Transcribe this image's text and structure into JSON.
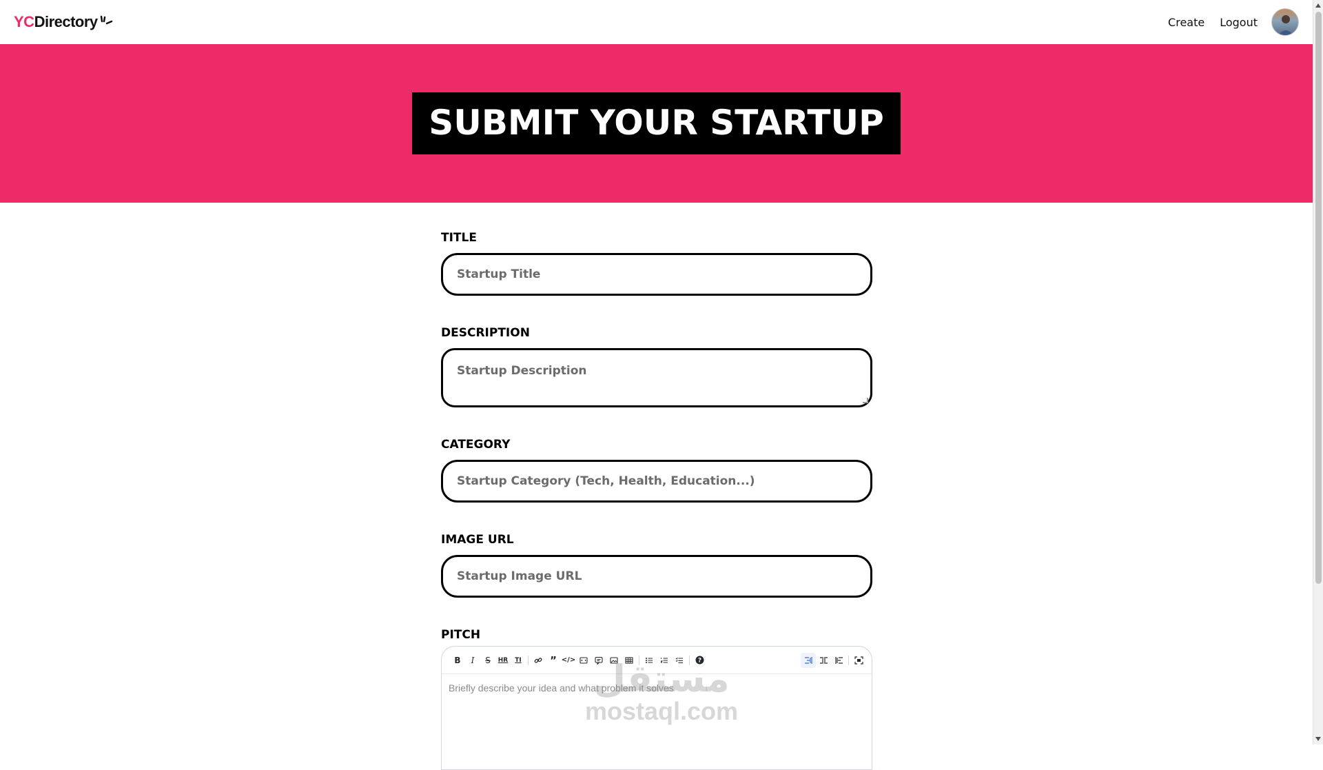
{
  "navbar": {
    "logo_yc": "YC",
    "logo_rest": "Directory",
    "links": [
      "Create",
      "Logout"
    ]
  },
  "hero": {
    "title": "SUBMIT YOUR STARTUP"
  },
  "form": {
    "title": {
      "label": "Title",
      "placeholder": "Startup Title"
    },
    "description": {
      "label": "Description",
      "placeholder": "Startup Description"
    },
    "category": {
      "label": "Category",
      "placeholder": "Startup Category (Tech, Health, Education...)"
    },
    "image_url": {
      "label": "Image URL",
      "placeholder": "Startup Image URL"
    },
    "pitch": {
      "label": "Pitch",
      "placeholder": "Briefly describe your idea and what problem it solves"
    }
  },
  "editor_toolbar": {
    "left": [
      "bold-icon",
      "italic-icon",
      "strikethrough-icon",
      "hr-icon",
      "title-icon",
      "|",
      "link-icon",
      "quote-icon",
      "code-icon",
      "code-block-icon",
      "comment-icon",
      "image-icon",
      "table-icon",
      "|",
      "unordered-list-icon",
      "ordered-list-icon",
      "checked-list-icon",
      "|",
      "help-icon"
    ],
    "right": [
      "edit-mode-icon",
      "live-mode-icon",
      "preview-mode-icon",
      "|",
      "fullscreen-icon"
    ]
  },
  "watermark": {
    "arabic": "مستقل",
    "latin": "mostaql.com"
  },
  "colors": {
    "brand_pink": "#EE2B69",
    "black": "#000000",
    "placeholder": "#6b6b6b"
  }
}
